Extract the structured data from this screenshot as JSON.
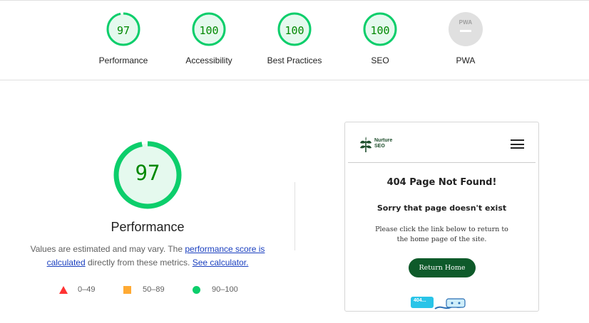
{
  "categories": [
    {
      "label": "Performance",
      "score": "97",
      "score_value": 97,
      "color": "#0cce6b"
    },
    {
      "label": "Accessibility",
      "score": "100",
      "score_value": 100,
      "color": "#0cce6b"
    },
    {
      "label": "Best Practices",
      "score": "100",
      "score_value": 100,
      "color": "#0cce6b"
    },
    {
      "label": "SEO",
      "score": "100",
      "score_value": 100,
      "color": "#0cce6b"
    },
    {
      "label": "PWA",
      "badge_text": "PWA",
      "color": "#e0e0e0"
    }
  ],
  "main": {
    "score": "97",
    "score_value": 97,
    "title": "Performance",
    "desc_prefix": "Values are estimated and may vary. The ",
    "desc_link1": "performance score is calculated",
    "desc_middle": " directly from these metrics. ",
    "desc_link2": "See calculator.",
    "legend": [
      {
        "range": "0–49",
        "icon": "triangle-icon",
        "color": "#ff3333"
      },
      {
        "range": "50–89",
        "icon": "square-icon",
        "color": "#ffaa33"
      },
      {
        "range": "90–100",
        "icon": "circle-icon",
        "color": "#0cce6b"
      }
    ]
  },
  "screenshot": {
    "brand_line1": "Nurture",
    "brand_line2": "SEO",
    "heading": "404 Page Not Found!",
    "subheading": "Sorry that page doesn't exist",
    "paragraph": "Please click the link below to return to the home page of the site.",
    "button": "Return Home",
    "badge": "404..."
  },
  "colors": {
    "pass_green": "#0cce6b",
    "score_text_green": "#008800",
    "link_blue": "#1a3fbf",
    "brand_green": "#0e5a2a"
  }
}
